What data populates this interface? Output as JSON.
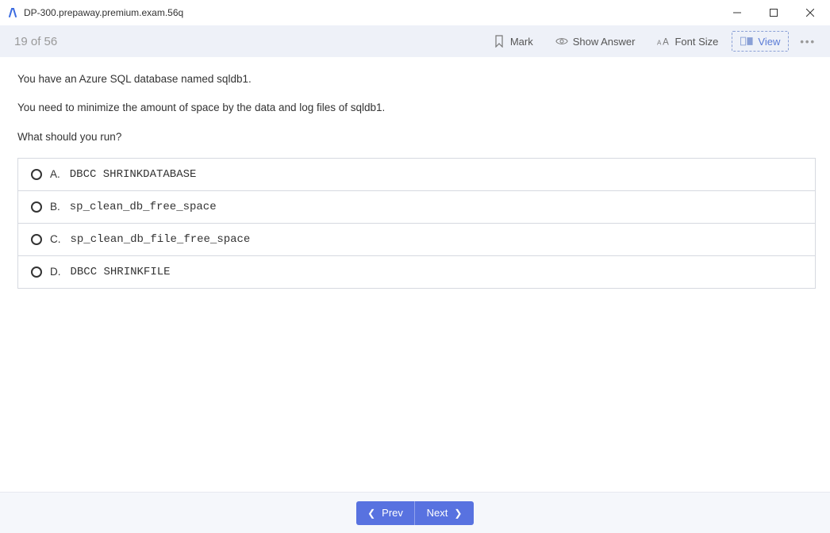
{
  "window": {
    "title": "DP-300.prepaway.premium.exam.56q"
  },
  "toolbar": {
    "progress": "19 of 56",
    "mark": "Mark",
    "show_answer": "Show Answer",
    "font_size": "Font Size",
    "view": "View"
  },
  "question": {
    "p1": "You have an Azure SQL database named sqldb1.",
    "p2": "You need to minimize the amount of space by the data and log files of sqldb1.",
    "p3": "What should you run?"
  },
  "options": {
    "a": {
      "letter": "A.",
      "text": "DBCC SHRINKDATABASE"
    },
    "b": {
      "letter": "B.",
      "text": "sp_clean_db_free_space"
    },
    "c": {
      "letter": "C.",
      "text": "sp_clean_db_file_free_space"
    },
    "d": {
      "letter": "D.",
      "text": "DBCC SHRINKFILE"
    }
  },
  "nav": {
    "prev": "Prev",
    "next": "Next"
  }
}
